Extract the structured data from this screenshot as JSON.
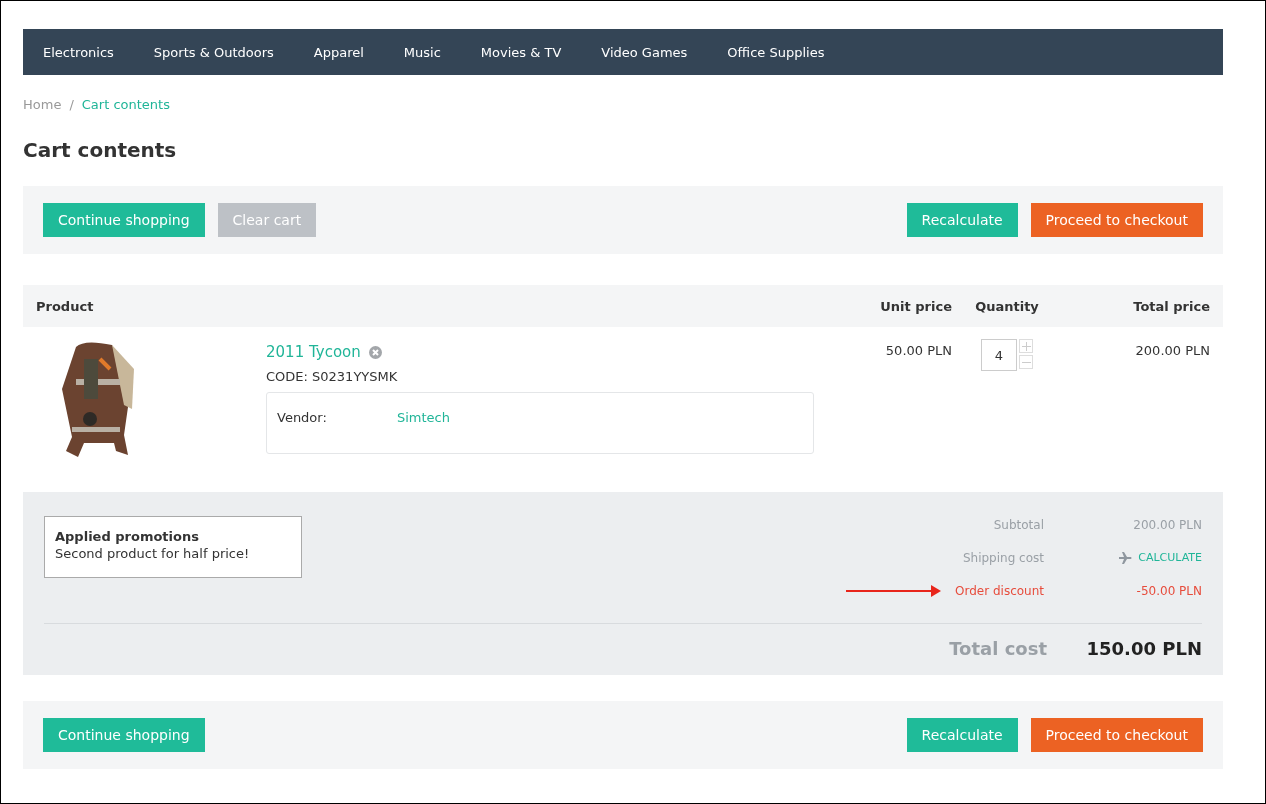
{
  "nav": [
    {
      "label": "Electronics"
    },
    {
      "label": "Sports & Outdoors"
    },
    {
      "label": "Apparel"
    },
    {
      "label": "Music"
    },
    {
      "label": "Movies & TV"
    },
    {
      "label": "Video Games"
    },
    {
      "label": "Office Supplies"
    }
  ],
  "breadcrumb_separator": "/",
  "breadcrumbs": [
    {
      "label": "Home",
      "selected": false
    },
    {
      "label": "Cart contents",
      "selected": true
    }
  ],
  "title": "Cart contents",
  "top_buttons": {
    "left": [
      {
        "label": "Continue shopping",
        "kind": "primary"
      },
      {
        "label": "Clear cart",
        "kind": "muted"
      }
    ],
    "right": [
      {
        "label": "Recalculate",
        "kind": "primary"
      },
      {
        "label": "Proceed to checkout",
        "kind": "accent"
      }
    ]
  },
  "table": {
    "columns": [
      "Product",
      "Unit price",
      "Quantity",
      "Total price"
    ],
    "rows": [
      {
        "name": "2011 Tycoon",
        "code": "CODE: S0231YYSMK",
        "vendor_label": "Vendor:",
        "vendor": "Simtech",
        "unit_price": "50.00 PLN",
        "quantity": "4",
        "total": "200.00 PLN"
      }
    ]
  },
  "promotions": {
    "title": "Applied promotions",
    "text": "Second product for half price!"
  },
  "totals": [
    {
      "kind": "plain",
      "label": "Subtotal",
      "value": "200.00 PLN"
    },
    {
      "kind": "link",
      "label": "Shipping cost",
      "value": "CALCULATE"
    },
    {
      "kind": "discount",
      "label": "Order discount",
      "value": "-50.00 PLN"
    }
  ],
  "total": {
    "label": "Total cost",
    "value": "150.00 PLN"
  },
  "bottom_buttons": {
    "left": [
      {
        "label": "Continue shopping",
        "kind": "primary"
      }
    ],
    "right": [
      {
        "label": "Recalculate",
        "kind": "primary"
      },
      {
        "label": "Proceed to checkout",
        "kind": "accent"
      }
    ]
  }
}
